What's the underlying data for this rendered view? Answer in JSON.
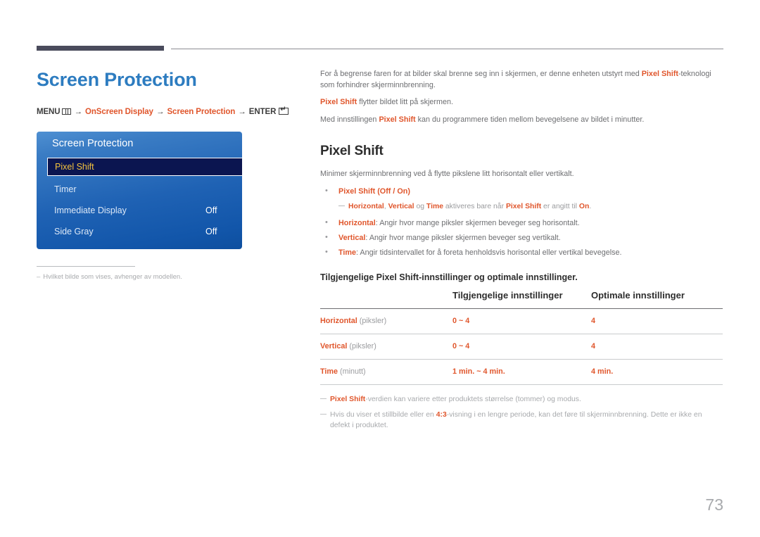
{
  "header": {
    "page_title": "Screen Protection"
  },
  "breadcrumb": {
    "menu_label": "MENU",
    "menu_icon": "menu-grid-icon",
    "arrow": "→",
    "step1": "OnScreen Display",
    "step2": "Screen Protection",
    "enter_label": "ENTER",
    "enter_icon": "enter-return-icon"
  },
  "osd": {
    "title": "Screen Protection",
    "items": [
      {
        "label": "Pixel Shift",
        "value": "",
        "selected": true
      },
      {
        "label": "Timer",
        "value": "",
        "selected": false
      },
      {
        "label": "Immediate Display",
        "value": "Off",
        "selected": false
      },
      {
        "label": "Side Gray",
        "value": "Off",
        "selected": false
      }
    ]
  },
  "left_footnote": {
    "dash": "–",
    "text": "Hvilket bilde som vises, avhenger av modellen."
  },
  "intro": {
    "p1_a": "For å begrense faren for at bilder skal brenne seg inn i skjermen, er denne enheten utstyrt med ",
    "p1_b": "Pixel Shift",
    "p1_c": "-teknologi som forhindrer skjerminnbrenning.",
    "p2_a": "Pixel Shift",
    "p2_b": " flytter bildet litt på skjermen.",
    "p3_a": "Med innstillingen ",
    "p3_b": "Pixel Shift",
    "p3_c": " kan du programmere tiden mellom bevegelsene av bildet i minutter."
  },
  "section": {
    "title": "Pixel Shift",
    "intro": "Minimer skjerminnbrenning ved å flytte pikslene litt horisontalt eller vertikalt.",
    "bullets": [
      {
        "term": "Pixel Shift",
        "rest": " (Off / On)",
        "opt_off": "Off",
        "opt_on": "On",
        "style": "options"
      },
      {
        "term": "Horizontal",
        "rest": ": Angir hvor mange piksler skjermen beveger seg horisontalt.",
        "style": "plain"
      },
      {
        "term": "Vertical",
        "rest": ": Angir hvor mange piksler skjermen beveger seg vertikalt.",
        "style": "plain"
      },
      {
        "term": "Time",
        "rest": ": Angir tidsintervallet for å foreta henholdsvis horisontal eller vertikal bevegelse.",
        "style": "plain"
      }
    ],
    "subnote": {
      "t1": "Horizontal",
      "sep1": ", ",
      "t2": "Vertical",
      "mid1": " og ",
      "t3": "Time",
      "mid2": " aktiveres bare når ",
      "t4": "Pixel Shift",
      "mid3": " er angitt til ",
      "t5": "On",
      "end": "."
    }
  },
  "table": {
    "caption": "Tilgjengelige Pixel Shift-innstillinger og optimale innstillinger.",
    "headers": [
      "",
      "Tilgjengelige innstillinger",
      "Optimale innstillinger"
    ],
    "rows": [
      {
        "term": "Horizontal",
        "unit": " (piksler)",
        "available": "0 ~ 4",
        "optimal": "4"
      },
      {
        "term": "Vertical",
        "unit": " (piksler)",
        "available": "0 ~ 4",
        "optimal": "4"
      },
      {
        "term": "Time",
        "unit": " (minutt)",
        "available": "1 min. ~ 4 min.",
        "optimal": "4 min."
      }
    ]
  },
  "footnotes": [
    {
      "a": "Pixel Shift",
      "b": "-verdien kan variere etter produktets størrelse (tommer) og modus."
    },
    {
      "a": "4:3",
      "pre": "Hvis du viser et stillbilde eller en ",
      "b": "-visning i en lengre periode, kan det føre til skjerminnbrenning. Dette er ikke en defekt i produktet."
    }
  ],
  "page_number": "73",
  "colors": {
    "accent": "#e0562c",
    "title_blue": "#2d7cc0",
    "osd_selected_text": "#f4c33d",
    "rule_dark": "#4a4b5c"
  }
}
